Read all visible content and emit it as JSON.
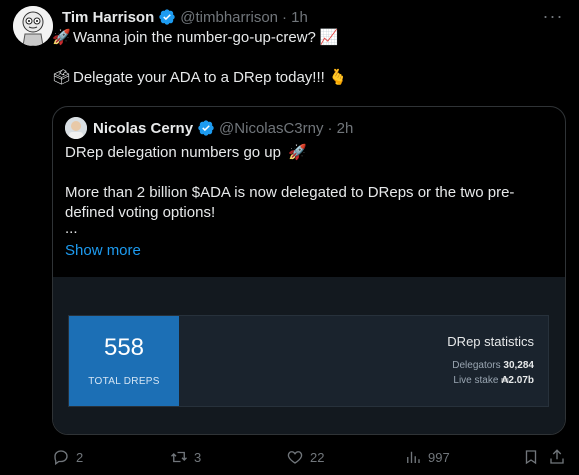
{
  "tweet": {
    "author_name": "Tim Harrison",
    "author_handle": "@timbharrison",
    "time": "· 1h",
    "line1": "Wanna join the number-go-up-crew?",
    "line2": "Delegate your ADA to a DRep today!!!"
  },
  "quote": {
    "author_name": "Nicolas Cerny",
    "author_handle": "@NicolasC3rny",
    "time": "· 2h",
    "text1": "DRep delegation numbers go up",
    "text2": "More than 2 billion $ADA is now delegated to DReps or the two pre-",
    "text3": "defined voting options!",
    "text4": "...",
    "show_more": "Show more"
  },
  "media_card": {
    "big_number": "558",
    "big_label": "TOTAL DREPS",
    "title": "DRep statistics",
    "rows": [
      {
        "label": "Delegators",
        "value": "30,284"
      },
      {
        "label": "Live stake",
        "value": "₳2.07b"
      }
    ]
  },
  "actions": {
    "replies": "2",
    "reposts": "3",
    "likes": "22",
    "views": "997"
  },
  "colors": {
    "accent": "#1d9bf0",
    "muted": "#71767b",
    "card_blue": "#1c6fb5"
  }
}
